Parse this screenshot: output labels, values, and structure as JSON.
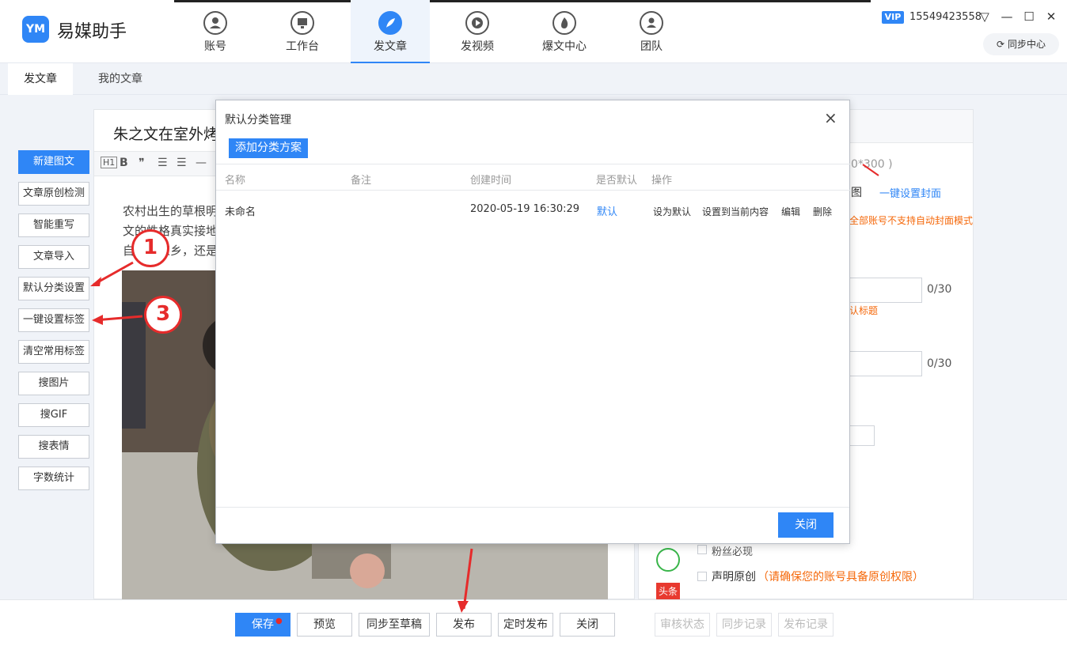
{
  "app": {
    "name": "易媒助手",
    "logo_text": "YM"
  },
  "nav": [
    {
      "label": "账号",
      "icon": "user-icon"
    },
    {
      "label": "工作台",
      "icon": "monitor-icon"
    },
    {
      "label": "发文章",
      "icon": "feather-icon",
      "active": true
    },
    {
      "label": "发视频",
      "icon": "play-icon"
    },
    {
      "label": "爆文中心",
      "icon": "fire-icon"
    },
    {
      "label": "团队",
      "icon": "team-icon"
    }
  ],
  "account": {
    "vip": "VIP",
    "phone": "15549423558",
    "sync_center": "同步中心"
  },
  "subtabs": [
    "发文章",
    "我的文章"
  ],
  "tools": [
    "新建图文",
    "文章原创检测",
    "智能重写",
    "文章导入",
    "默认分类设置",
    "一键设置标签",
    "清空常用标签",
    "搜图片",
    "搜GIF",
    "搜表情",
    "字数统计"
  ],
  "editor": {
    "title": "朱之文在室外烤",
    "body_lines": [
      "农村出生的草根明",
      "文的性格真实接地",
      "自己的家乡，还是"
    ]
  },
  "right_panel": {
    "size_hint": "0*300 )",
    "pic_frag": "图",
    "one_click_cover": "一键设置封面",
    "cover_warn": "全部账号不支持自动封面模式",
    "count1": "0/30",
    "title_hint": "认标题",
    "count2": "0/30",
    "fans_visible": "粉丝必现",
    "declare_original": "声明原创",
    "declare_note": "（请确保您的账号具备原创权限）",
    "toutiao_badge": "头条"
  },
  "bottom": {
    "save": "保存",
    "preview": "预览",
    "sync_draft": "同步至草稿",
    "publish": "发布",
    "schedule": "定时发布",
    "close": "关闭",
    "audit": "审核状态",
    "sync_log": "同步记录",
    "publish_log": "发布记录"
  },
  "modal": {
    "title": "默认分类管理",
    "add_button": "添加分类方案",
    "columns": [
      "名称",
      "备注",
      "创建时间",
      "是否默认",
      "操作"
    ],
    "rows": [
      {
        "name": "未命名",
        "note": "",
        "created": "2020-05-19 16:30:29",
        "is_default": "默认",
        "actions": [
          "设为默认",
          "设置到当前内容",
          "编辑",
          "删除"
        ]
      }
    ],
    "close_button": "关闭"
  },
  "annotations": [
    "1",
    "3"
  ],
  "colors": {
    "accent": "#2f86f6",
    "annotation": "#e62b2b",
    "warning": "#f5680a"
  }
}
